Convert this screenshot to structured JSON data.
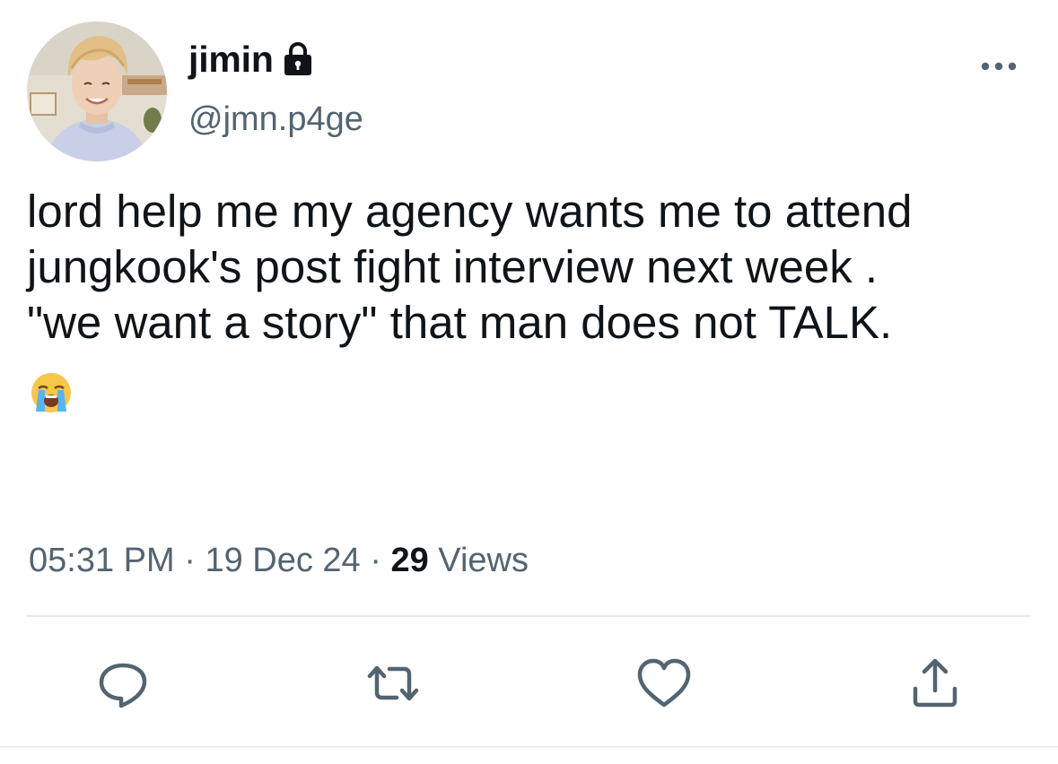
{
  "user": {
    "display_name": "jimin",
    "handle": "@jmn.p4ge",
    "locked": true,
    "avatar_icon": "profile-avatar"
  },
  "tweet": {
    "text": "lord help me my agency wants me to attend\njungkook's post fight interview next week .\n\"we want a story\" that man does not TALK.",
    "emoji": "😭",
    "time": "05:31 PM",
    "separator": "·",
    "date": "19 Dec 24",
    "views_count": "29",
    "views_label": "Views"
  },
  "icons": {
    "more": "more-icon",
    "lock": "lock-icon",
    "reply": "reply-icon",
    "retweet": "retweet-icon",
    "like": "heart-icon",
    "share": "share-icon"
  },
  "colors": {
    "text_primary": "#0f1419",
    "text_secondary": "#536471",
    "icon_gray": "#536471",
    "divider": "#e6e8ea"
  }
}
